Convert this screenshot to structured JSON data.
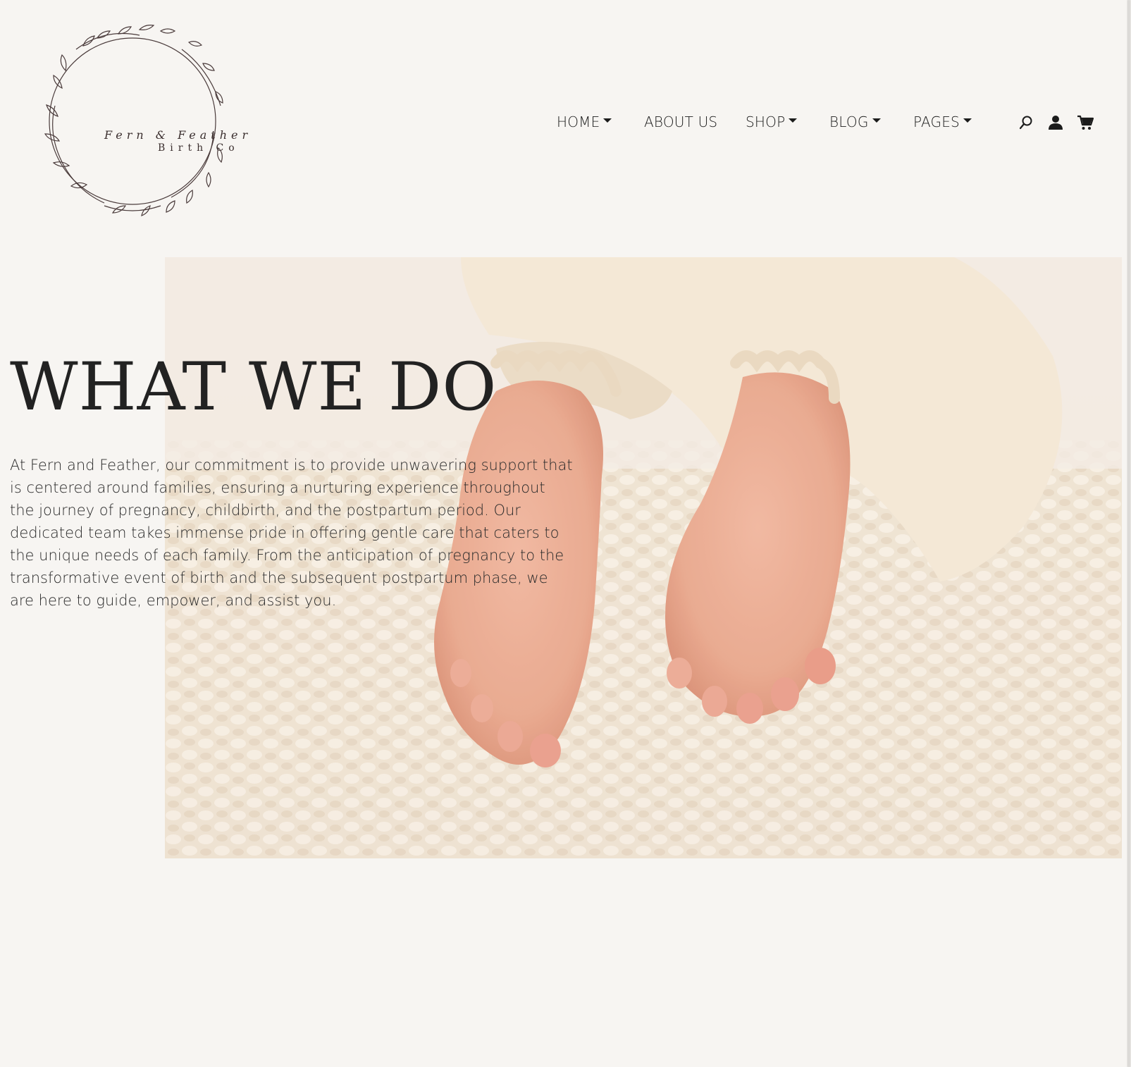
{
  "brand": {
    "line1": "Fern & Feather",
    "line2": "Birth Co"
  },
  "nav": {
    "home": "HOME",
    "about": "ABOUT US",
    "shop": "SHOP",
    "blog": "BLOG",
    "pages": "PAGES"
  },
  "icons": [
    "search-icon",
    "user-icon",
    "cart-icon"
  ],
  "hero": {
    "heading": "WHAT WE DO",
    "body": "At Fern and Feather, our commitment is to provide unwavering support that is centered around families, ensuring a nurturing experience throughout the journey of pregnancy, childbirth, and the postpartum period. Our dedicated team takes immense pride in offering gentle care that caters to the unique needs of each family. From the anticipation of pregnancy to the transformative event of birth and the subsequent postpartum phase, we are here to guide, empower, and assist you."
  },
  "colors": {
    "background": "#f7f5f2",
    "text": "#222222"
  }
}
